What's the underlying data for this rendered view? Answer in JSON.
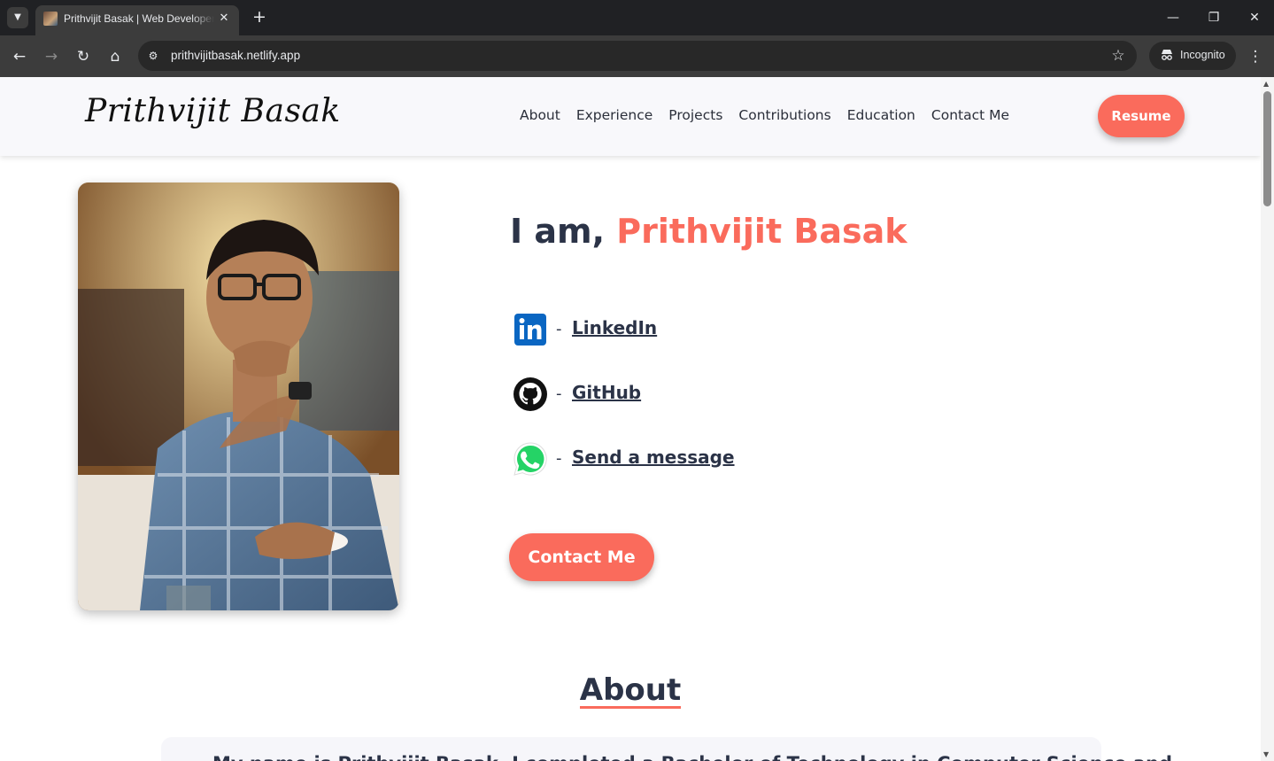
{
  "browser": {
    "tab_title": "Prithvijit Basak | Web Developer",
    "url": "prithvijitbasak.netlify.app",
    "incognito_label": "Incognito",
    "icons": {
      "tab_search": "chevron-down-icon",
      "close_tab": "close-icon",
      "new_tab": "plus-icon",
      "minimize": "minimize-icon",
      "restore": "restore-icon",
      "close_window": "close-icon",
      "back": "arrow-left-icon",
      "forward": "arrow-right-icon",
      "reload": "reload-icon",
      "home": "home-icon",
      "site_info": "tune-icon",
      "bookmark": "star-icon",
      "incognito": "incognito-icon",
      "menu": "kebab-icon"
    }
  },
  "site": {
    "logo": "Prithvijit Basak",
    "nav": [
      "About",
      "Experience",
      "Projects",
      "Contributions",
      "Education",
      "Contact Me"
    ],
    "resume_label": "Resume",
    "hero": {
      "prefix": "I am, ",
      "name": "Prithvijit Basak"
    },
    "social": [
      {
        "icon": "linkedin-icon",
        "dash": "-",
        "label": "LinkedIn"
      },
      {
        "icon": "github-icon",
        "dash": "-",
        "label": "GitHub"
      },
      {
        "icon": "whatsapp-icon",
        "dash": "-",
        "label": "Send a message"
      }
    ],
    "contact_label": "Contact Me",
    "about": {
      "heading": "About",
      "text": "My name is Prithvijit Basak. I completed a Bachelor of Technology in Computer Science and"
    },
    "colors": {
      "accent": "#fa6b5c",
      "text_dark": "#2b3347",
      "linkedin": "#0a66c2",
      "whatsapp": "#25d366",
      "github": "#111111"
    }
  }
}
